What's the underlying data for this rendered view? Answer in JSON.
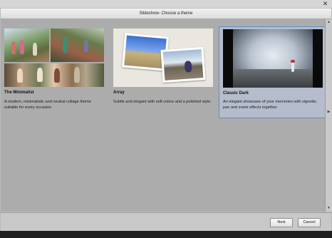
{
  "window": {
    "title": "Slideshow- Choose a theme",
    "close_glyph": "✕"
  },
  "themes": [
    {
      "name": "The Minimalist",
      "description": "A modern, minimalistic and neutral collage theme suitable for every occasion",
      "selected": false
    },
    {
      "name": "Array",
      "description": "Subtle and elegant with soft colors and a polished style.",
      "selected": false
    },
    {
      "name": "Classic Dark",
      "description": "An elegant showcase of your memories with vignette, pan and zoom effects together.",
      "selected": true
    }
  ],
  "footer": {
    "next_label": "Next",
    "cancel_label": "Cancel"
  },
  "colors": {
    "selection_outline": "#5b8fd1",
    "content_bg": "#acacac"
  }
}
